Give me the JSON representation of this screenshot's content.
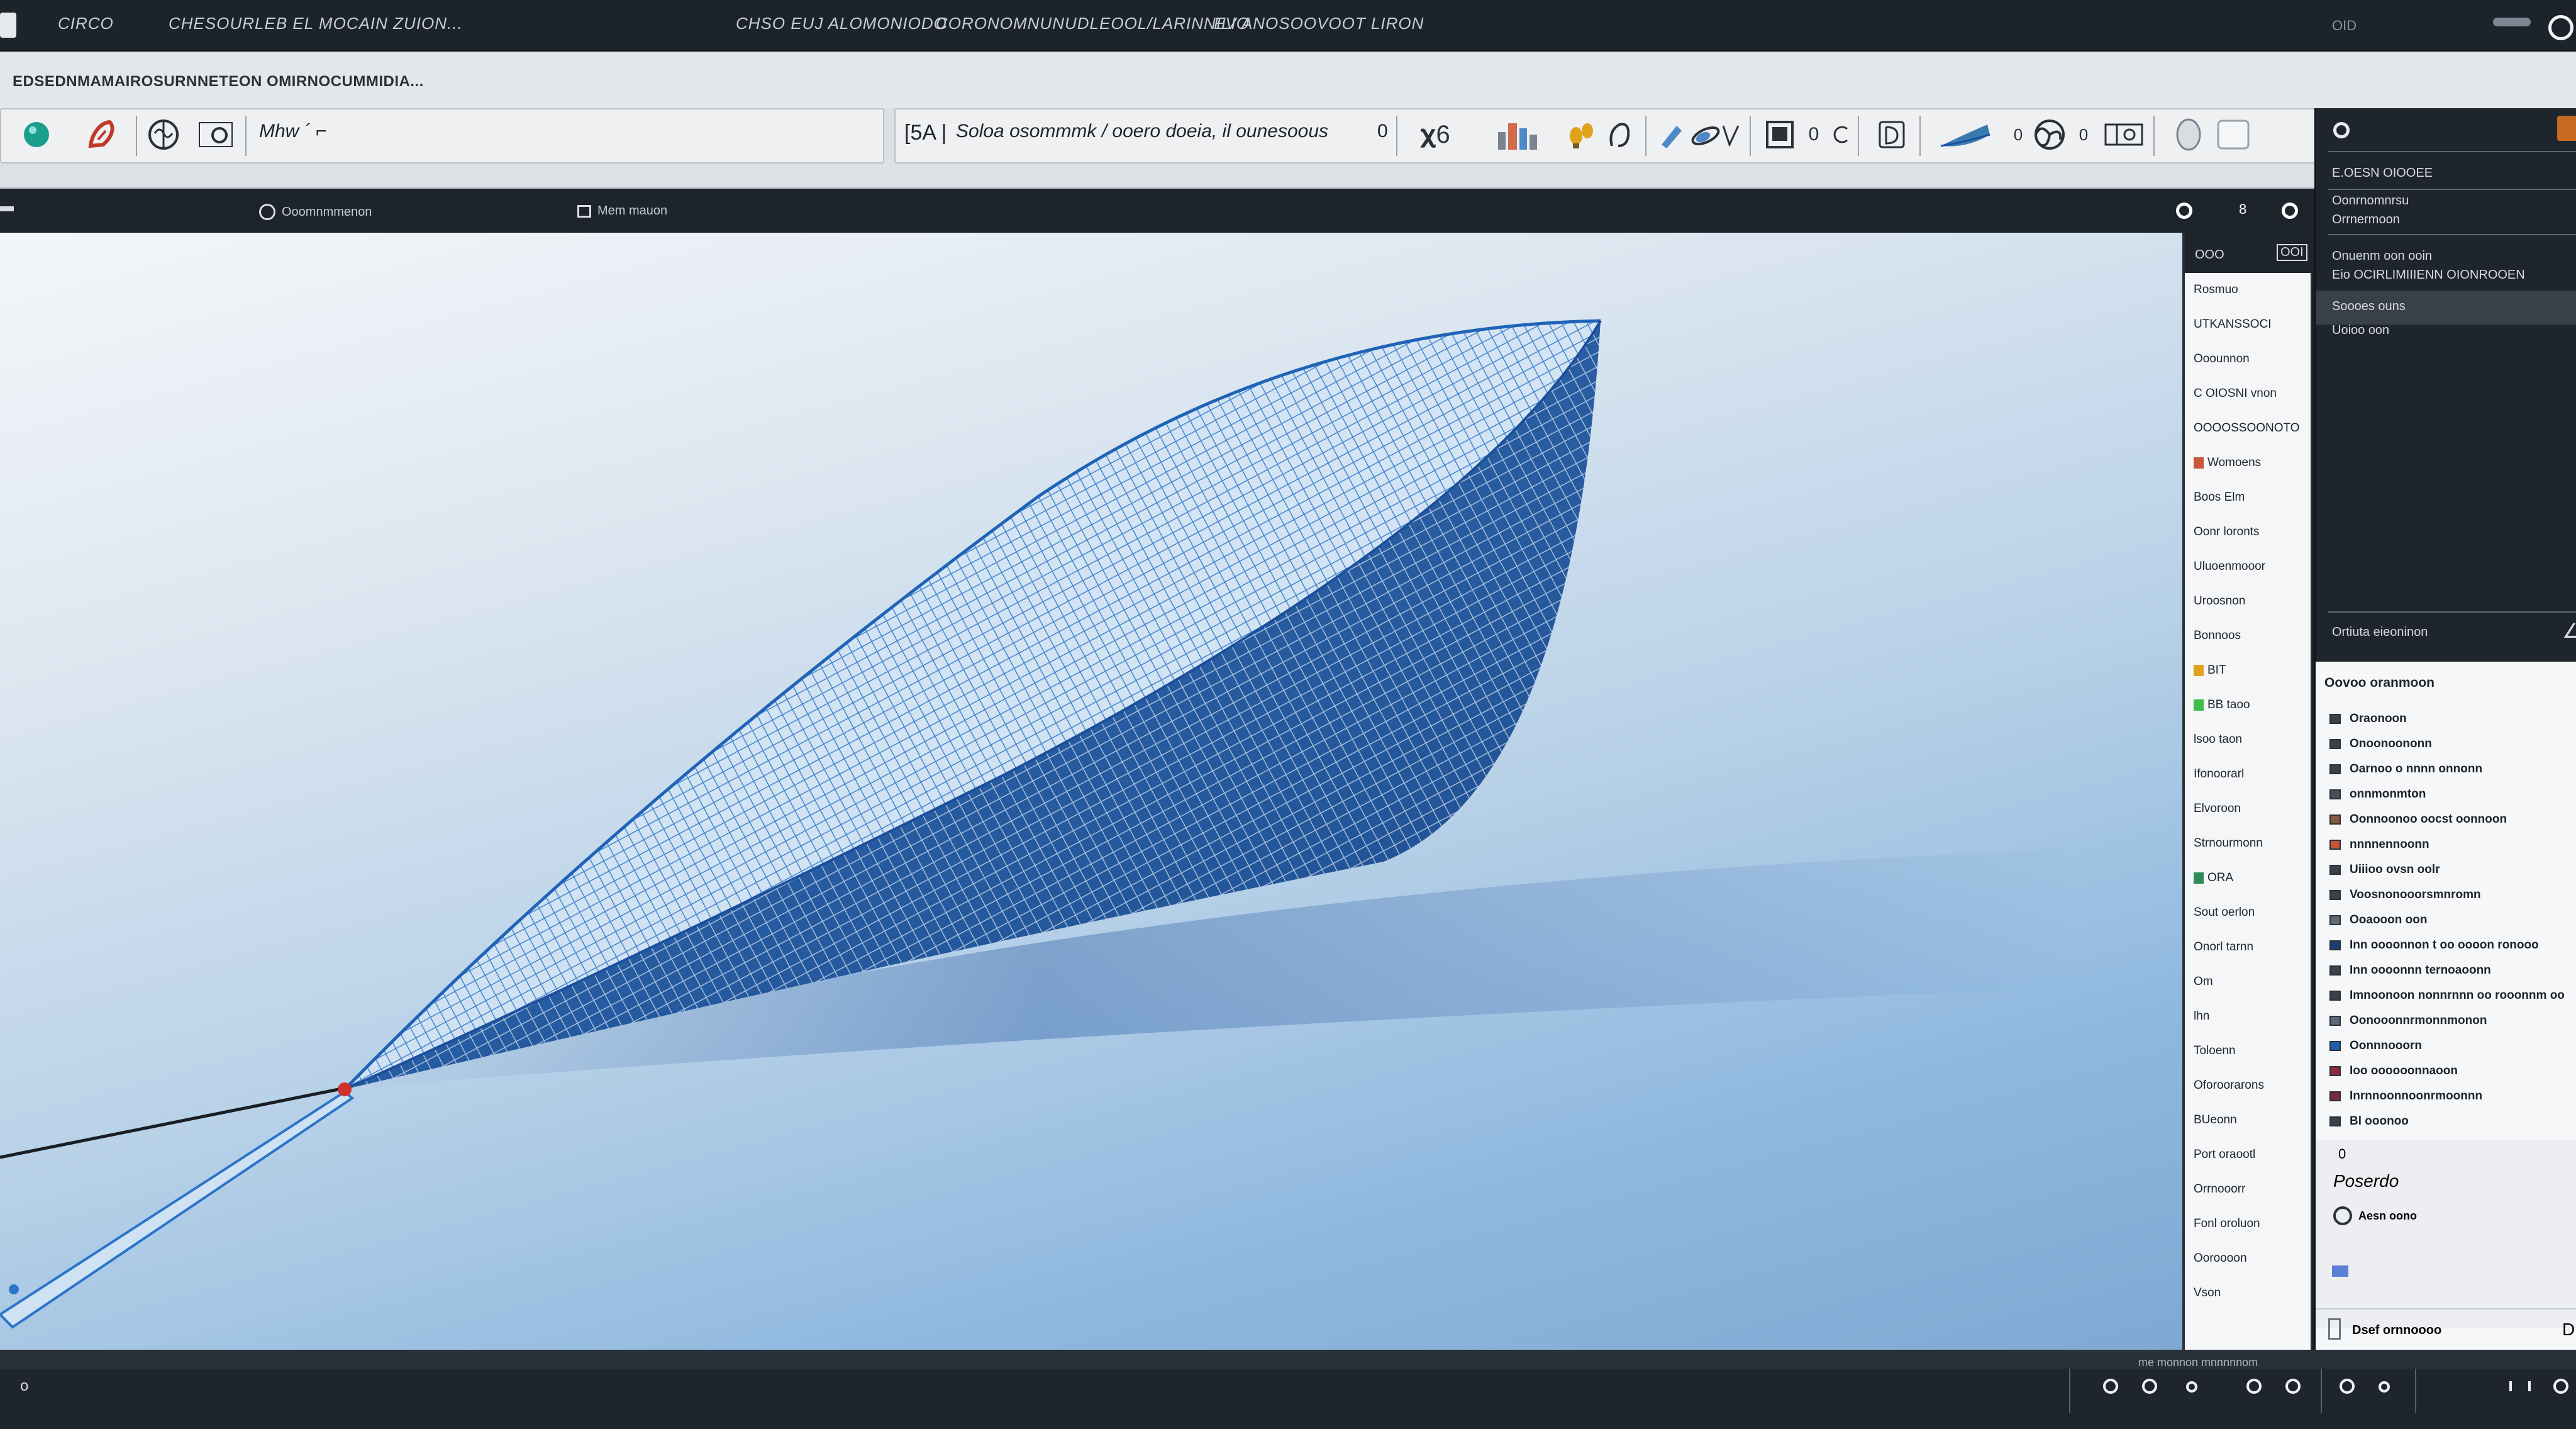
{
  "titlebar": {
    "items": [
      "CIRCO",
      "CHESOURLEB EL MOCAIN ZUION...",
      "CHSO EUJ ALOMONIODO",
      "CORONOMNUNUDLEOOL/LARINNILIO",
      "EV ANOSOOVOOT LIRON"
    ],
    "right_text": "OID"
  },
  "menustrip": {
    "text": "EDSEDNMAMAIROSURNNETEON OMIRNOCUMMIDIA..."
  },
  "toolbar": {
    "style_label": "Mhw ´ ⌐",
    "path_label": "Soloa osommmk / ooero doeia, il ounesoous",
    "zero": "0",
    "bracket_label": "[5A |",
    "count": "0"
  },
  "viewport_tabs": {
    "tab1": "Ooomnmmenon",
    "tab2": "Mem mauon",
    "ctrl_mid": "8"
  },
  "palette": {
    "header_left": "OOO",
    "header_right": "OOI",
    "items": [
      "Rosmuo",
      "UTKANSSOCI",
      "Ooounnon",
      "C OIOSNI vnon",
      "OOOOSSOONOTO",
      "Womoens",
      "Boos  Elm",
      "Oonr loronts",
      "Uluoenmooor",
      "Uroosnon",
      "Bonnoos",
      "BIT",
      "BB taoo",
      "lsoo taon",
      "Ifonoorarl",
      "Elvoroon",
      "Strnourmonn",
      "ORA",
      "Sout oerlon",
      "Onorl tarnn",
      "Om",
      "lhn",
      "Toloenn",
      "Oforoorarons",
      "BUeonn",
      "Port oraootl",
      "Orrnooorr",
      "Fonl oroluon",
      "Ooroooon",
      "Vson"
    ]
  },
  "props": {
    "rows": [
      "E.OESN OIOOEE",
      "Oonrnomnrsu",
      "Orrnermoon",
      "Onuenm oon ooin",
      "Eio OCIRLIMIIIENN OIONROOEN",
      "Soooes ouns",
      "Uoioo oon",
      "Ortiuta eieoninon"
    ]
  },
  "layers": {
    "header": "Oovoo oranmoon",
    "items": [
      {
        "label": "Oraonoon",
        "color": "#3b4148"
      },
      {
        "label": "Onoonoononn",
        "color": "#3b4148"
      },
      {
        "label": "Oarnoo o nnnn onnonn",
        "color": "#3b4148"
      },
      {
        "label": "onnmonmton",
        "color": "#4a5058"
      },
      {
        "label": "Oonnoonoo oocst oonnoon",
        "color": "#8a5a3e"
      },
      {
        "label": "nnnnennoonn",
        "color": "#c8553a"
      },
      {
        "label": "Uiiioo ovsn oolr",
        "color": "#3b4148"
      },
      {
        "label": "Voosnonooorsmnromn",
        "color": "#3b4148"
      },
      {
        "label": "Ooaooon oon",
        "color": "#5e6a78"
      },
      {
        "label": "Inn oooonnon t oo oooon ronooo",
        "color": "#1b3d72"
      },
      {
        "label": "Inn oooonnn ternoaoonn",
        "color": "#3b4148"
      },
      {
        "label": "Imnoonoon nonnrnnn oo rooonnm oo",
        "color": "#3b4148"
      },
      {
        "label": "Oonooonnrmonnmonon",
        "color": "#5a6a79"
      },
      {
        "label": "Oonnnooorn",
        "color": "#1f5fa8"
      },
      {
        "label": "Ioo oooooonnaoon",
        "color": "#8e2a3a"
      },
      {
        "label": "Inrnnoonnoonrmoonnn",
        "color": "#7a2a3a"
      },
      {
        "label": "Bl ooonoo",
        "color": "#3b4148"
      }
    ],
    "count_zero": "0",
    "mode_label": "Poserdo",
    "radio_label": "Aesn oono",
    "footer_label": "Dsef ornnoooo",
    "footer_right": "D"
  },
  "statusbar": {
    "left": "o",
    "progress_text": "me monnon mnnnnnom"
  },
  "colors": {
    "accent_teal": "#1a9f8f",
    "accent_red": "#c0392b",
    "mesh_blue": "#2a74c9",
    "mesh_deep": "#1b4f9c",
    "panel_dark": "#1f252c",
    "swatch_orange": "#e0a21a",
    "swatch_green": "#3fbf4a"
  }
}
